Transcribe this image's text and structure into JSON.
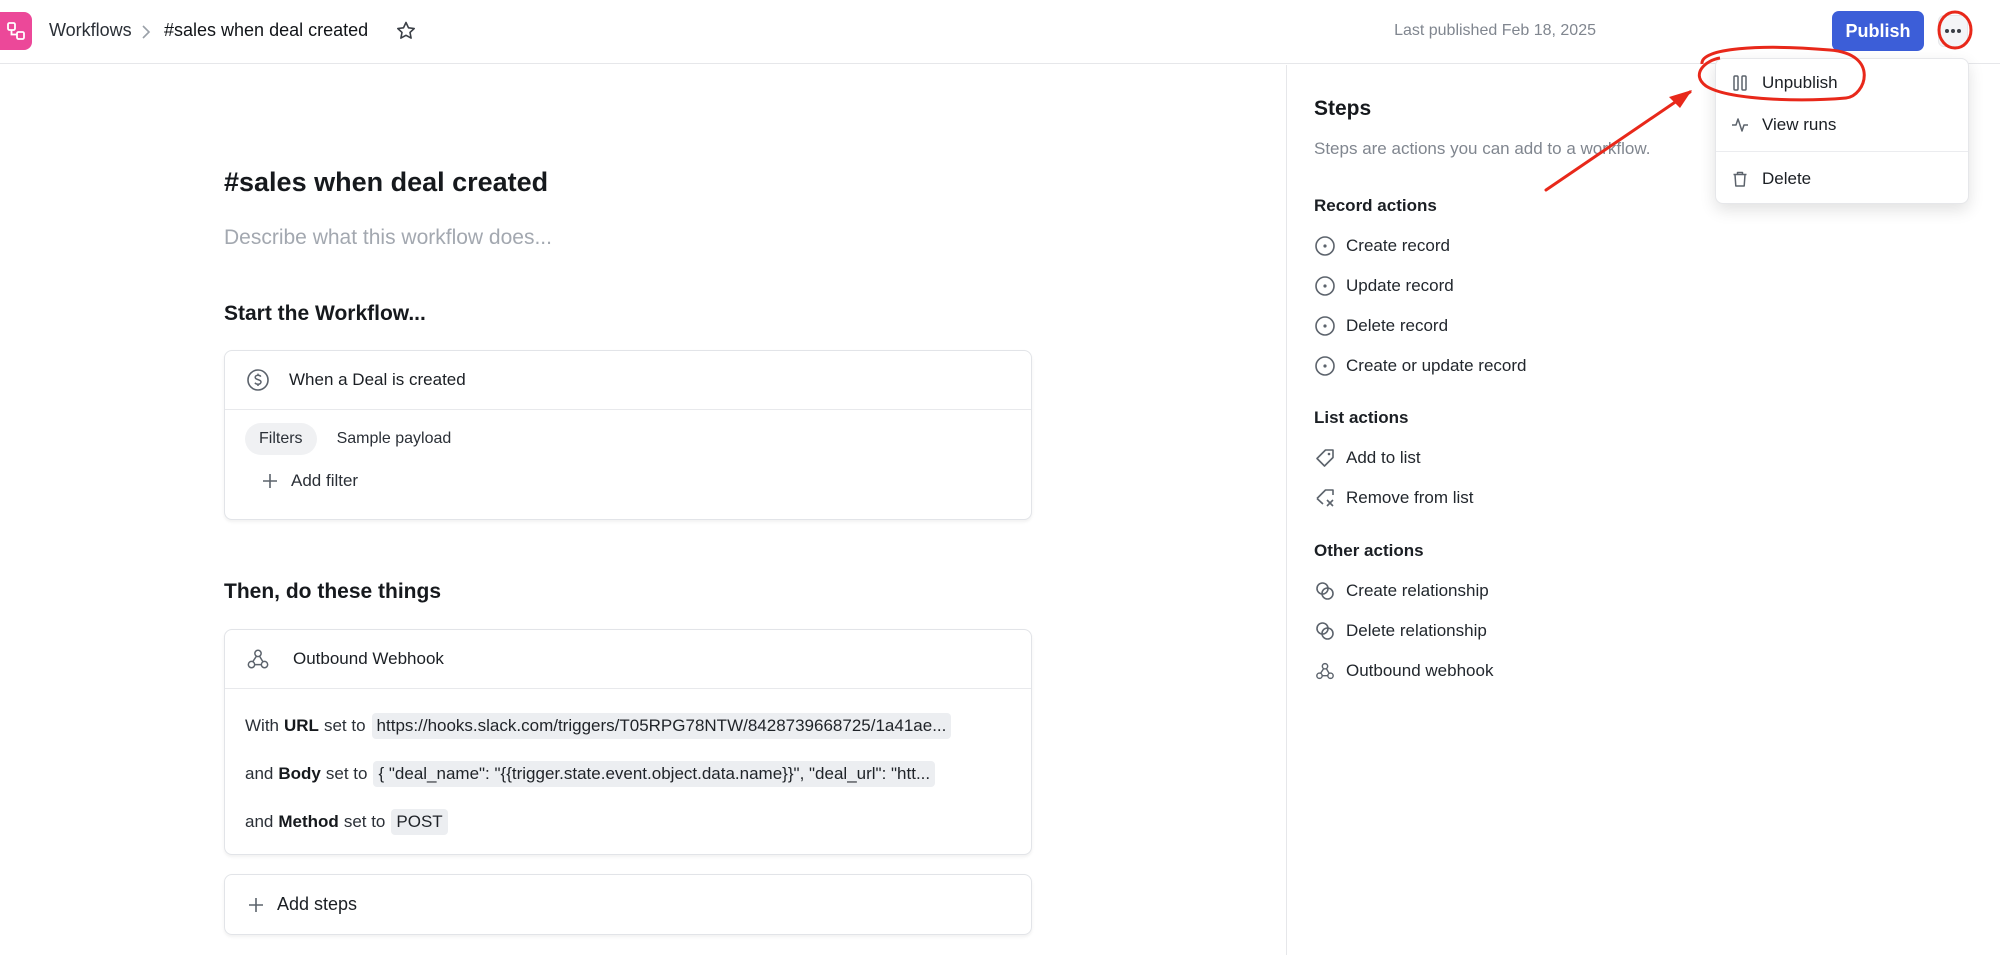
{
  "header": {
    "breadcrumb_root": "Workflows",
    "breadcrumb_current": "#sales when deal created",
    "last_published": "Last published Feb 18, 2025",
    "publish_label": "Publish",
    "logo_icon": "workflow-icon",
    "star_icon": "star-icon",
    "more_icon": "more-horizontal-icon"
  },
  "workflow": {
    "title": "#sales when deal created",
    "description_placeholder": "Describe what this workflow does...",
    "start_heading": "Start the Workflow...",
    "trigger": {
      "label": "When a Deal is created",
      "icon": "dollar-circle-icon",
      "tabs": [
        "Filters",
        "Sample payload"
      ],
      "active_tab": "Filters",
      "add_filter_label": "Add filter"
    },
    "then_heading": "Then, do these things",
    "step": {
      "label": "Outbound Webhook",
      "icon": "webhook-icon",
      "rows": [
        {
          "prefix": "With",
          "field": "URL",
          "mid": "set to",
          "value": "https://hooks.slack.com/triggers/T05RPG78NTW/8428739668725/1a41ae..."
        },
        {
          "prefix": "and",
          "field": "Body",
          "mid": "set to",
          "value": "{ \"deal_name\": \"{{trigger.state.event.object.data.name}}\", \"deal_url\": \"htt..."
        },
        {
          "prefix": "and",
          "field": "Method",
          "mid": "set to",
          "value": "POST"
        }
      ]
    },
    "add_steps_label": "Add steps"
  },
  "panel": {
    "title": "Steps",
    "subtitle": "Steps are actions you can add to a workflow.",
    "groups": [
      {
        "name": "Record actions",
        "items": [
          "Create record",
          "Update record",
          "Delete record",
          "Create or update record"
        ]
      },
      {
        "name": "List actions",
        "items": [
          "Add to list",
          "Remove from list"
        ]
      },
      {
        "name": "Other actions",
        "items": [
          "Create relationship",
          "Delete relationship",
          "Outbound webhook"
        ]
      }
    ]
  },
  "menu": {
    "items": [
      "Unpublish",
      "View runs",
      "Delete"
    ],
    "icons": [
      "pause-icon",
      "activity-icon",
      "trash-icon"
    ]
  },
  "colors": {
    "accent": "#3c5ed8",
    "logo": "#ec4899",
    "annotation": "#e8281a"
  }
}
